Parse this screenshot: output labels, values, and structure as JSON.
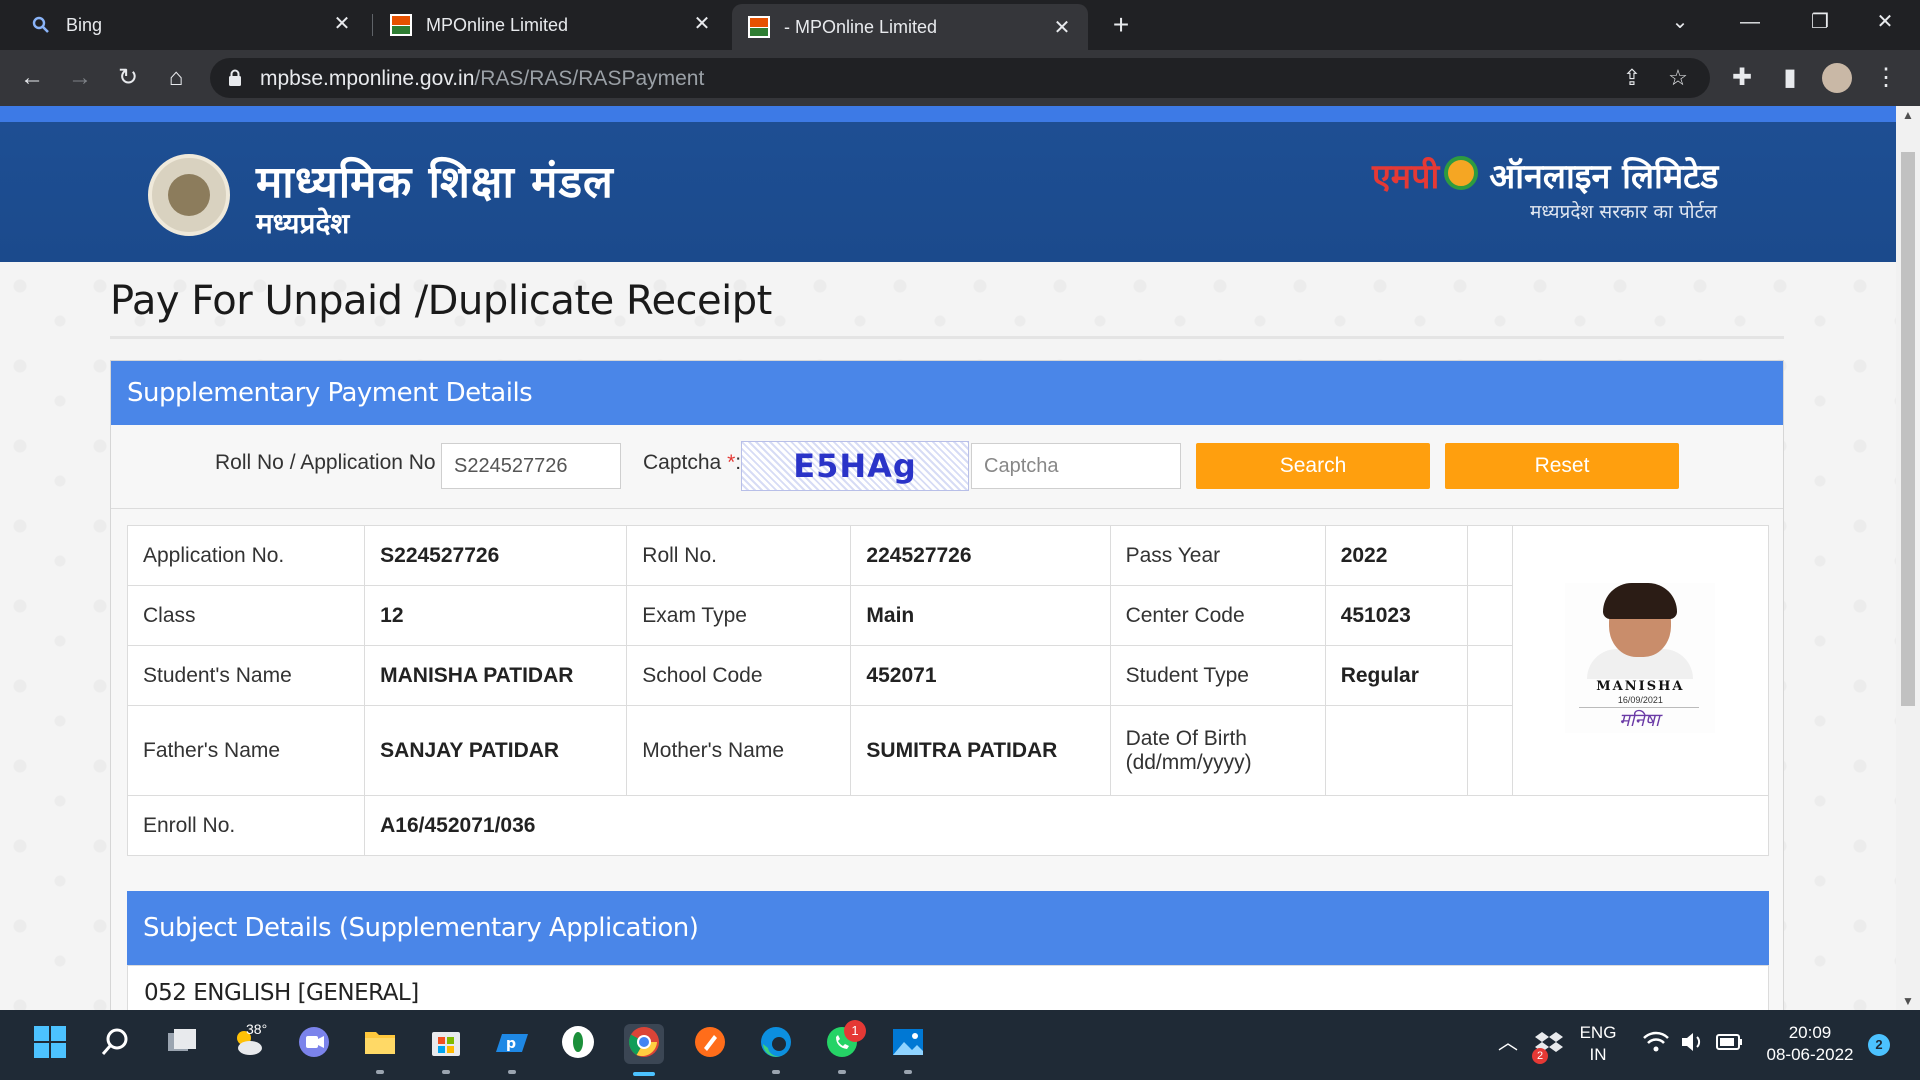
{
  "browser": {
    "tabs": [
      {
        "title": "Bing"
      },
      {
        "title": "MPOnline Limited"
      },
      {
        "title": "- MPOnline Limited"
      }
    ],
    "url_host": "mpbse.mponline.gov.in",
    "url_path": "/RAS/RAS/RASPayment"
  },
  "banner": {
    "org_name_line1": "माध्यमिक शिक्षा मंडल",
    "org_name_line2": "मध्यप्रदेश",
    "brand_part1": "एमपी",
    "brand_part2": "ऑनलाइन लिमिटेड",
    "brand_sub": "मध्यप्रदेश सरकार का पोर्टल"
  },
  "page": {
    "title": "Pay For Unpaid /Duplicate Receipt"
  },
  "payment_panel": {
    "heading": "Supplementary Payment Details",
    "roll_label": "Roll No / Application No",
    "roll_value": "S224527726",
    "captcha_label": "Captcha",
    "captcha_image_text": "E5HAg",
    "captcha_placeholder": "Captcha",
    "required_mark": "*",
    "search_label": "Search",
    "reset_label": "Reset"
  },
  "student": {
    "application_no_label": "Application No.",
    "application_no": "S224527726",
    "roll_no_label": "Roll No.",
    "roll_no": "224527726",
    "pass_year_label": "Pass Year",
    "pass_year": "2022",
    "class_label": "Class",
    "class": "12",
    "exam_type_label": "Exam Type",
    "exam_type": "Main",
    "center_code_label": "Center Code",
    "center_code": "451023",
    "student_name_label": "Student's Name",
    "student_name": "MANISHA PATIDAR",
    "school_code_label": "School Code",
    "school_code": "452071",
    "student_type_label": "Student Type",
    "student_type": "Regular",
    "father_name_label": "Father's Name",
    "father_name": "SANJAY PATIDAR",
    "mother_name_label": "Mother's Name",
    "mother_name": "SUMITRA PATIDAR",
    "dob_label_line1": "Date Of Birth",
    "dob_label_line2": "(dd/mm/yyyy)",
    "dob": "",
    "enroll_no_label": "Enroll No.",
    "enroll_no": "A16/452071/036",
    "photo_name": "MANISHA",
    "photo_date": "16/09/2021",
    "photo_signature": "मनिषा"
  },
  "subjects": {
    "heading": "Subject Details (Supplementary Application)",
    "first_subject": "052 ENGLISH [GENERAL]"
  },
  "taskbar": {
    "weather_temp": "38°",
    "lang_line1": "ENG",
    "lang_line2": "IN",
    "time": "20:09",
    "date": "08-06-2022",
    "notification_count": "2",
    "whatsapp_badge": "1",
    "tray_badge": "2"
  }
}
